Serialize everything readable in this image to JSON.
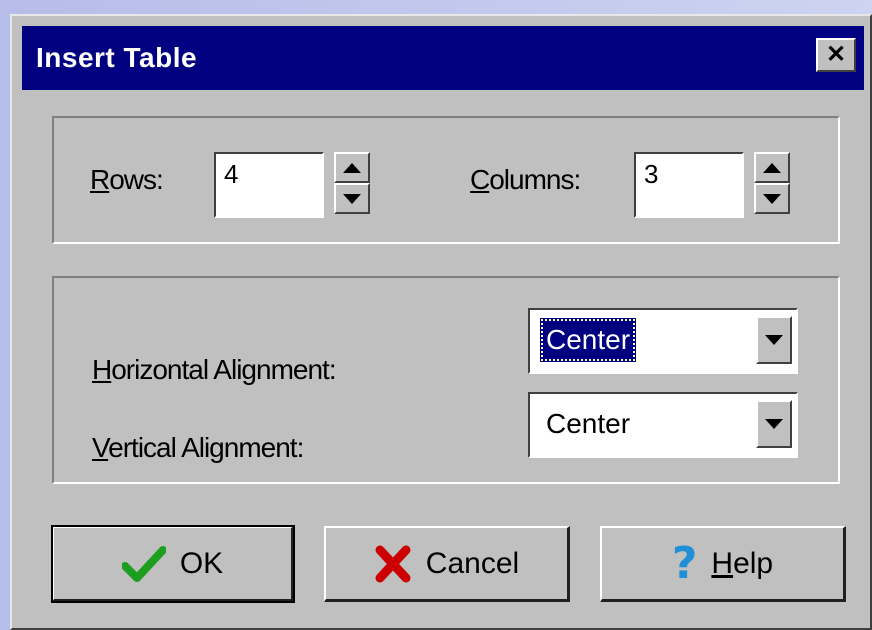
{
  "window": {
    "title": "Insert Table",
    "close_glyph": "✕"
  },
  "size_group": {
    "rows_label_mnemonic": "R",
    "rows_label_rest": "ows:",
    "rows_value": "4",
    "columns_label_mnemonic": "C",
    "columns_label_rest": "olumns:",
    "columns_value": "3"
  },
  "alignment_group": {
    "horizontal_label_mnemonic": "H",
    "horizontal_label_rest": "orizontal Alignment:",
    "horizontal_value": "Center",
    "vertical_label_mnemonic": "V",
    "vertical_label_rest": "ertical Alignment:",
    "vertical_value": "Center"
  },
  "buttons": {
    "ok_label": "OK",
    "cancel_label": "Cancel",
    "help_mnemonic": "H",
    "help_rest": "elp"
  },
  "colors": {
    "titlebar": "#000080",
    "face": "#c0c0c0",
    "ok_icon": "#1e9e1e",
    "cancel_icon": "#cc0000",
    "help_icon": "#1f8fd6"
  },
  "icons": {
    "ok": "checkmark-icon",
    "cancel": "x-icon",
    "help": "question-mark-icon"
  }
}
